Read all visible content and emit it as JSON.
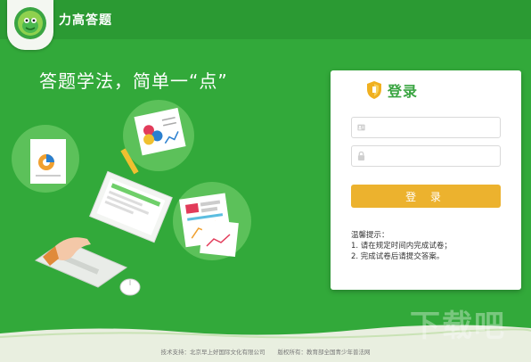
{
  "app": {
    "title": "力高答题",
    "slogan": "答题学法，简单一“点”"
  },
  "login": {
    "title": "登录",
    "username_placeholder": "",
    "password_placeholder": "",
    "button_label": "登 录",
    "tips_title": "温馨提示：",
    "tips": [
      "1. 请在规定时间内完成试卷；",
      "2. 完成试卷后请提交答案。"
    ]
  },
  "footer": {
    "support": "技术支持：北京早上好国际文化有限公司",
    "copyright": "版权所有：教育部全国青少年普法网"
  },
  "watermark": "下载吧",
  "colors": {
    "background": "#32a93a",
    "accent_green": "#3aa542",
    "button": "#ecb22e"
  },
  "icons": [
    "mascot-logo-icon",
    "shield-icon",
    "user-card-icon",
    "lock-icon"
  ]
}
